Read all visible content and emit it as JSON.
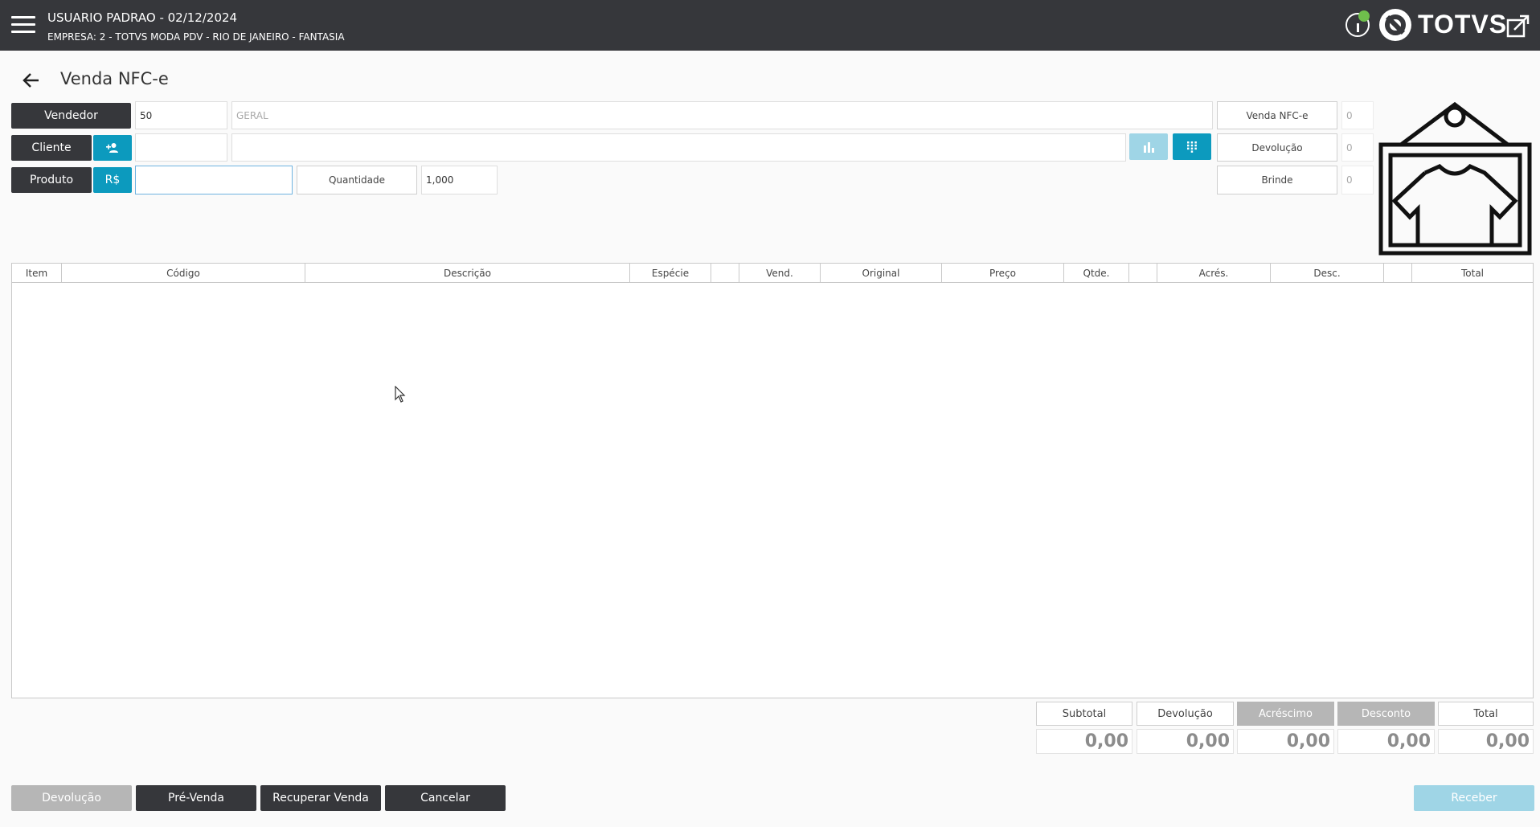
{
  "header": {
    "user_line": "USUARIO PADRAO - 02/12/2024",
    "company_line": "EMPRESA: 2 - TOTVS MODA PDV - RIO DE JANEIRO - FANTASIA",
    "brand": "TOTVS",
    "status_color": "#6fbf4c"
  },
  "page": {
    "title": "Venda NFC-e"
  },
  "form": {
    "vendedor_label": "Vendedor",
    "vendedor_code": "50",
    "vendedor_name": "GERAL",
    "cliente_label": "Cliente",
    "cliente_code": "",
    "cliente_name": "",
    "produto_label": "Produto",
    "price_button": "R$",
    "produto_code": "",
    "quantidade_label": "Quantidade",
    "quantidade_value": "1,000"
  },
  "counters": [
    {
      "label": "Venda NFC-e",
      "value": "0"
    },
    {
      "label": "Devolução",
      "value": "0"
    },
    {
      "label": "Brinde",
      "value": "0"
    }
  ],
  "table": {
    "columns": [
      "Item",
      "Código",
      "Descrição",
      "Espécie",
      "",
      "Vend.",
      "Original",
      "Preço",
      "Qtde.",
      "",
      "Acrés.",
      "Desc.",
      "",
      "Total"
    ],
    "rows": []
  },
  "totals": [
    {
      "label": "Subtotal",
      "value": "0,00"
    },
    {
      "label": "Devolução",
      "value": "0,00"
    },
    {
      "label": "Acréscimo",
      "value": "0,00"
    },
    {
      "label": "Desconto",
      "value": "0,00"
    },
    {
      "label": "Total",
      "value": "0,00"
    }
  ],
  "footer": {
    "devolucao": "Devolução",
    "pre_venda": "Pré-Venda",
    "recuperar": "Recuperar Venda",
    "cancelar": "Cancelar",
    "receber": "Receber"
  },
  "colors": {
    "dark": "#36373b",
    "accent": "#0c9abe",
    "disabled_accent": "#9fd5e6"
  },
  "icons": [
    "menu-icon",
    "info-icon",
    "totvs-logo-icon",
    "expand-icon",
    "back-arrow-icon",
    "add-person-icon",
    "chart-icon",
    "keypad-icon",
    "shirt-tag-icon"
  ]
}
